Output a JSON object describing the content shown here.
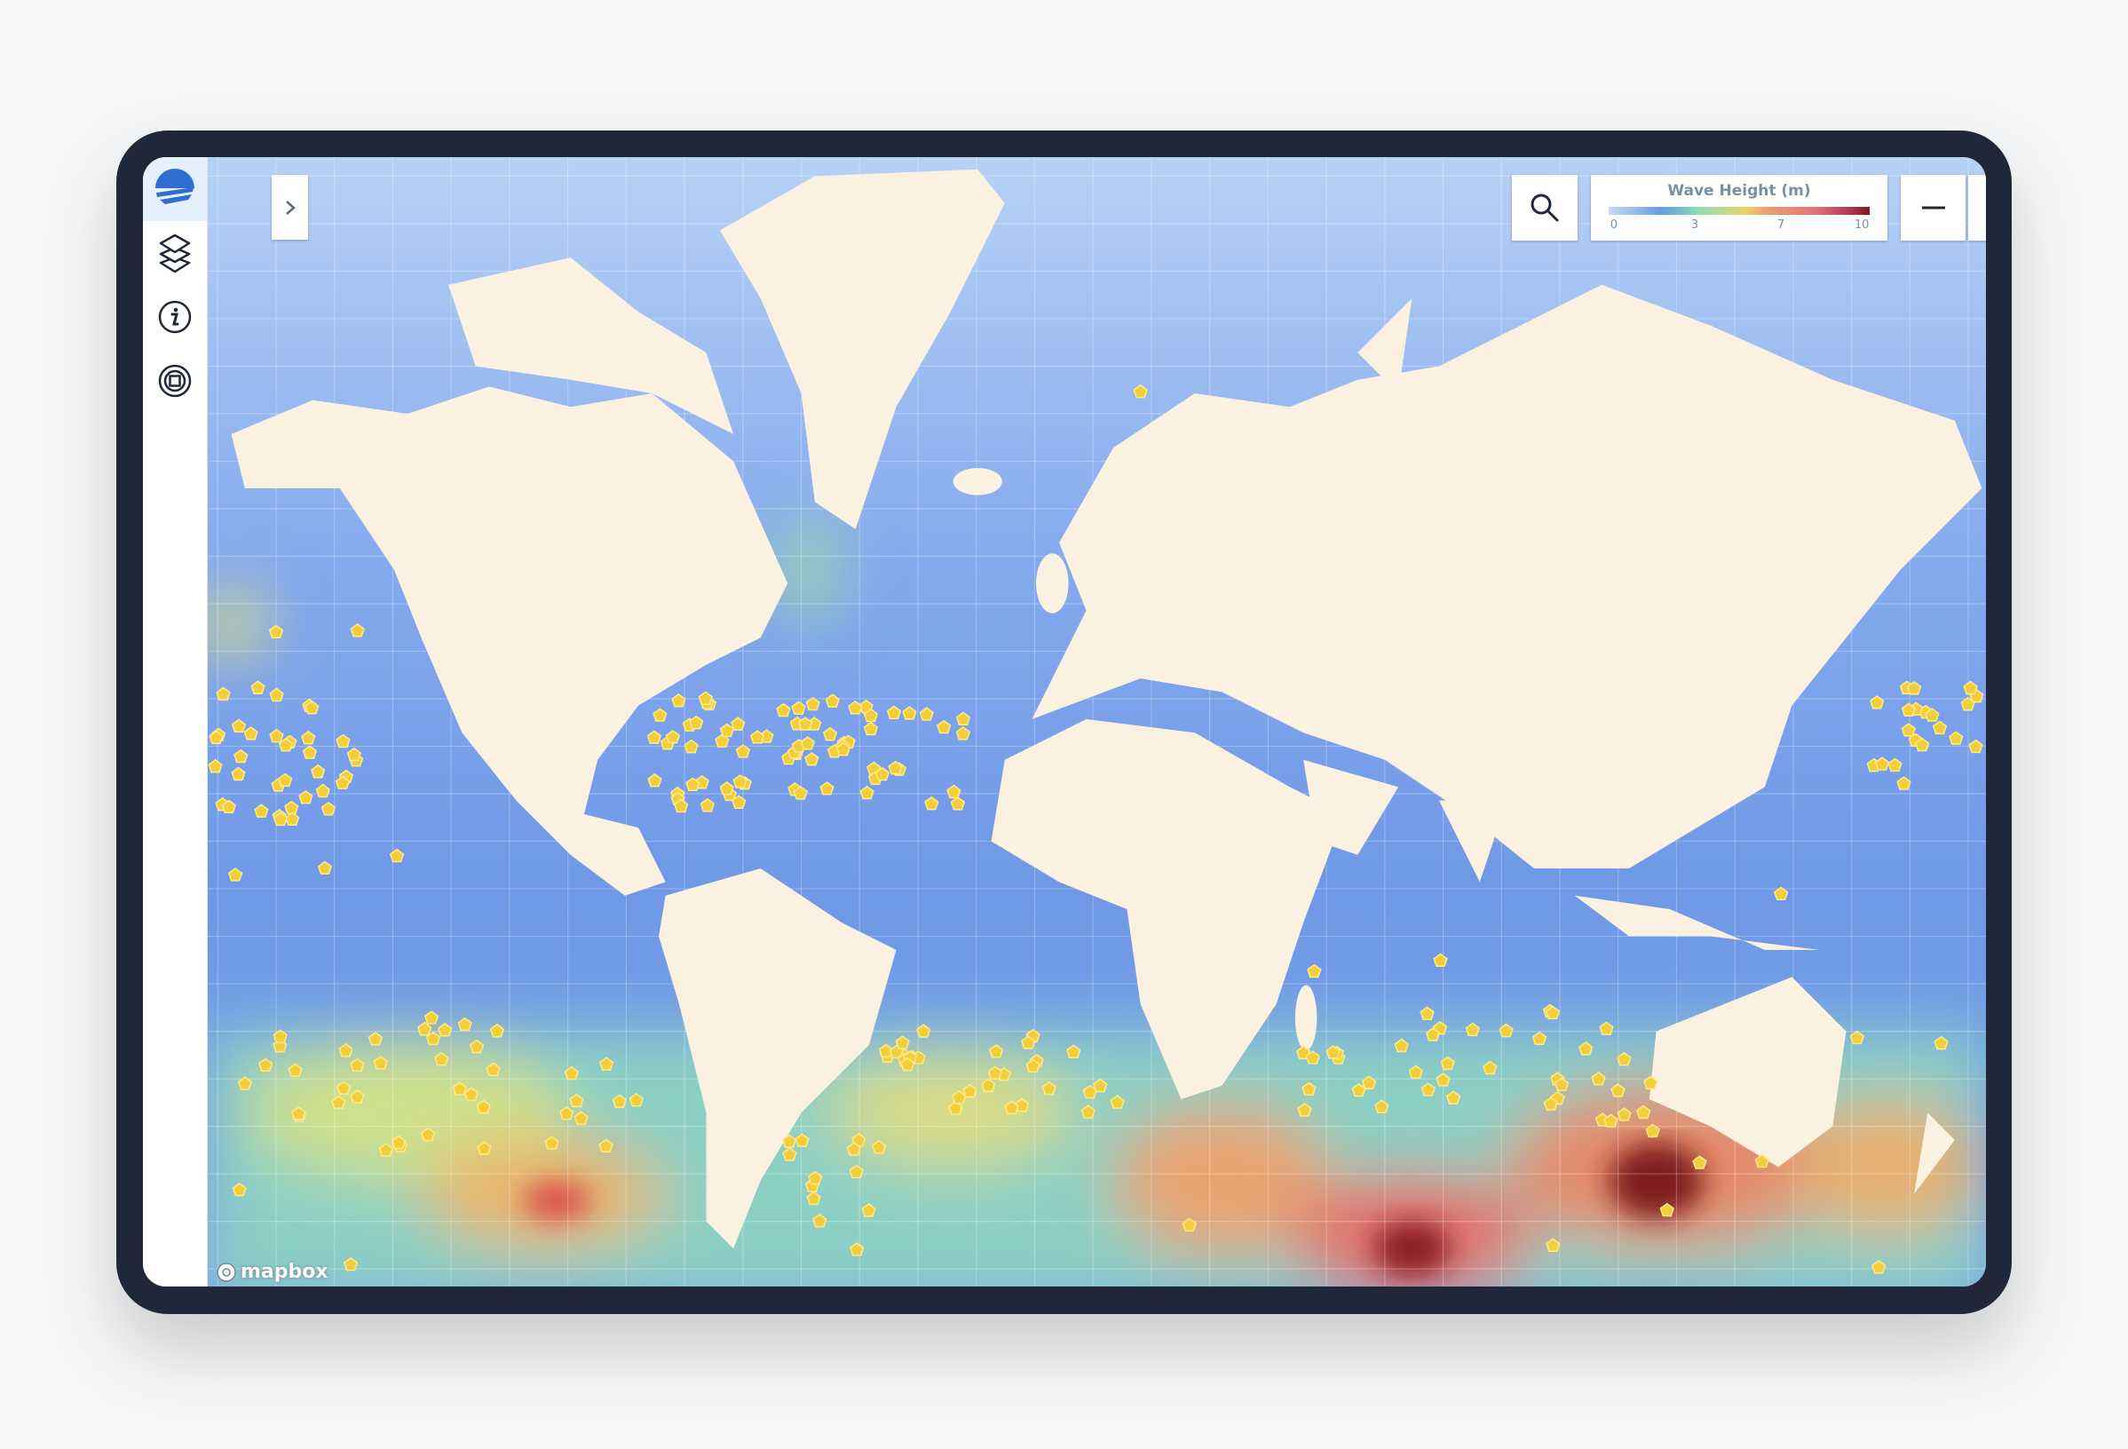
{
  "legend": {
    "title": "Wave Height (m)",
    "ticks": [
      "0",
      "3",
      "7",
      "10"
    ],
    "colors": [
      "#c4dbf6",
      "#6b9ae6",
      "#8fdcb8",
      "#e9d56a",
      "#e36f7a",
      "#7d1a1e"
    ]
  },
  "map": {
    "attribution": "mapbox",
    "ocean_color": "#7fa8ec",
    "land_color": "#fbf1e1",
    "marker_color": "#f2cf3a"
  },
  "sidebar": {
    "items": [
      {
        "icon": "logo-icon"
      },
      {
        "icon": "layers-icon"
      },
      {
        "icon": "info-icon"
      },
      {
        "icon": "target-icon"
      }
    ]
  }
}
